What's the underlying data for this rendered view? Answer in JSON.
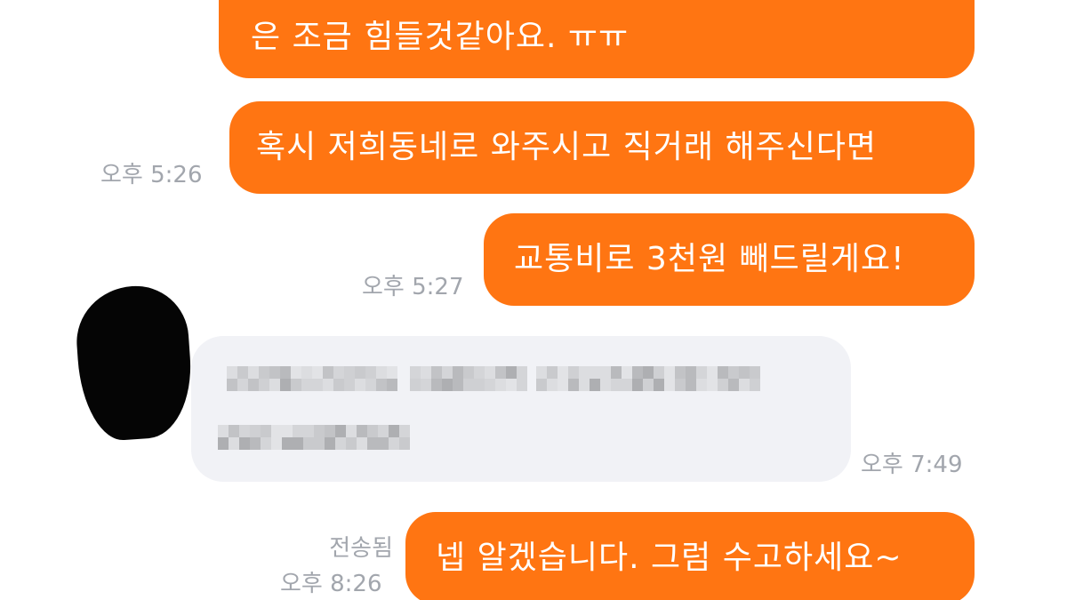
{
  "messages": [
    {
      "id": "m1",
      "direction": "outgoing",
      "text": "은 조금 힘들것같아요. ㅠㅠ",
      "time": ""
    },
    {
      "id": "m2",
      "direction": "outgoing",
      "text": "혹시 저희동네로 와주시고 직거래 해주신다면",
      "time": "오후 5:26"
    },
    {
      "id": "m3",
      "direction": "outgoing",
      "text": "교통비로 3천원 빼드릴게요!",
      "time": "오후 5:27"
    },
    {
      "id": "m4",
      "direction": "incoming",
      "text": "",
      "time": "오후 7:49"
    },
    {
      "id": "m5",
      "direction": "outgoing",
      "text": "넵 알겠습니다. 그럼 수고하세요~",
      "status": "전송됨",
      "time": "오후 8:26"
    }
  ],
  "colors": {
    "outgoing_bubble": "#ff7512",
    "incoming_bubble": "#f1f2f6",
    "meta_text": "#a2a6ad"
  }
}
